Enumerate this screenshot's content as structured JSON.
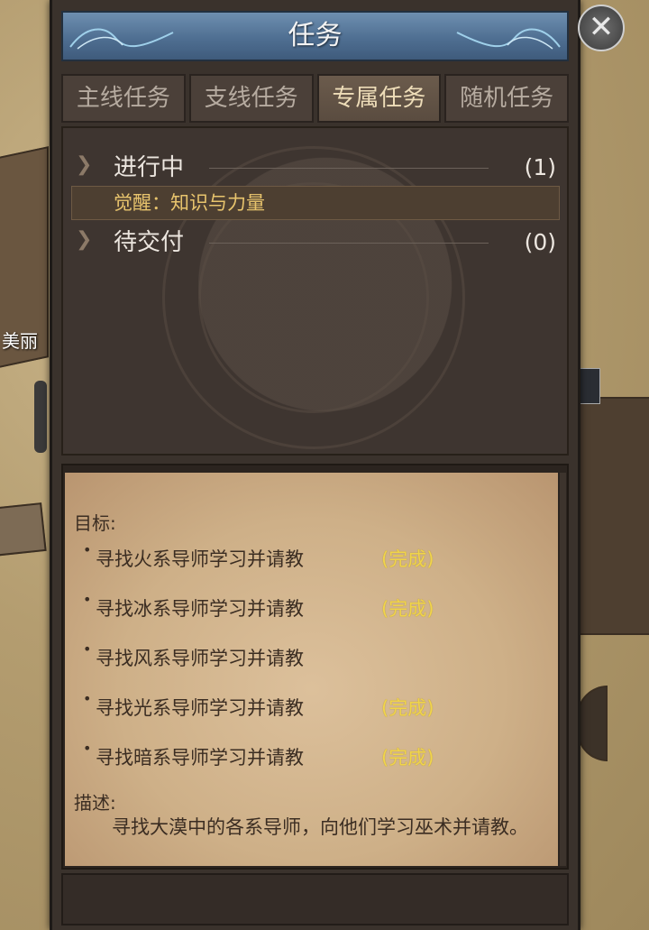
{
  "window": {
    "title": "任务",
    "close_symbol": "✕"
  },
  "tabs": [
    {
      "label": "主线任务",
      "active": false
    },
    {
      "label": "支线任务",
      "active": false
    },
    {
      "label": "专属任务",
      "active": true
    },
    {
      "label": "随机任务",
      "active": false
    }
  ],
  "groups": {
    "in_progress": {
      "label": "进行中",
      "count": "(1)"
    },
    "quest": {
      "label": "觉醒：知识与力量"
    },
    "to_submit": {
      "label": "待交付",
      "count": "(0)"
    }
  },
  "detail": {
    "objectives_heading": "目标:",
    "objectives": [
      {
        "text": "寻找火系导师学习并请教",
        "status": "(完成)"
      },
      {
        "text": "寻找冰系导师学习并请教",
        "status": "(完成)"
      },
      {
        "text": "寻找风系导师学习并请教",
        "status": ""
      },
      {
        "text": "寻找光系导师学习并请教",
        "status": "(完成)"
      },
      {
        "text": "寻找暗系导师学习并请教",
        "status": "(完成)"
      }
    ],
    "description_heading": "描述:",
    "description": "寻找大漠中的各系导师，向他们学习巫术并请教。"
  },
  "background": {
    "npc_name": "美丽"
  },
  "colors": {
    "accent_gold": "#f0d44a",
    "quest_text": "#e8c46d",
    "title_bar": "#4f6f92"
  }
}
